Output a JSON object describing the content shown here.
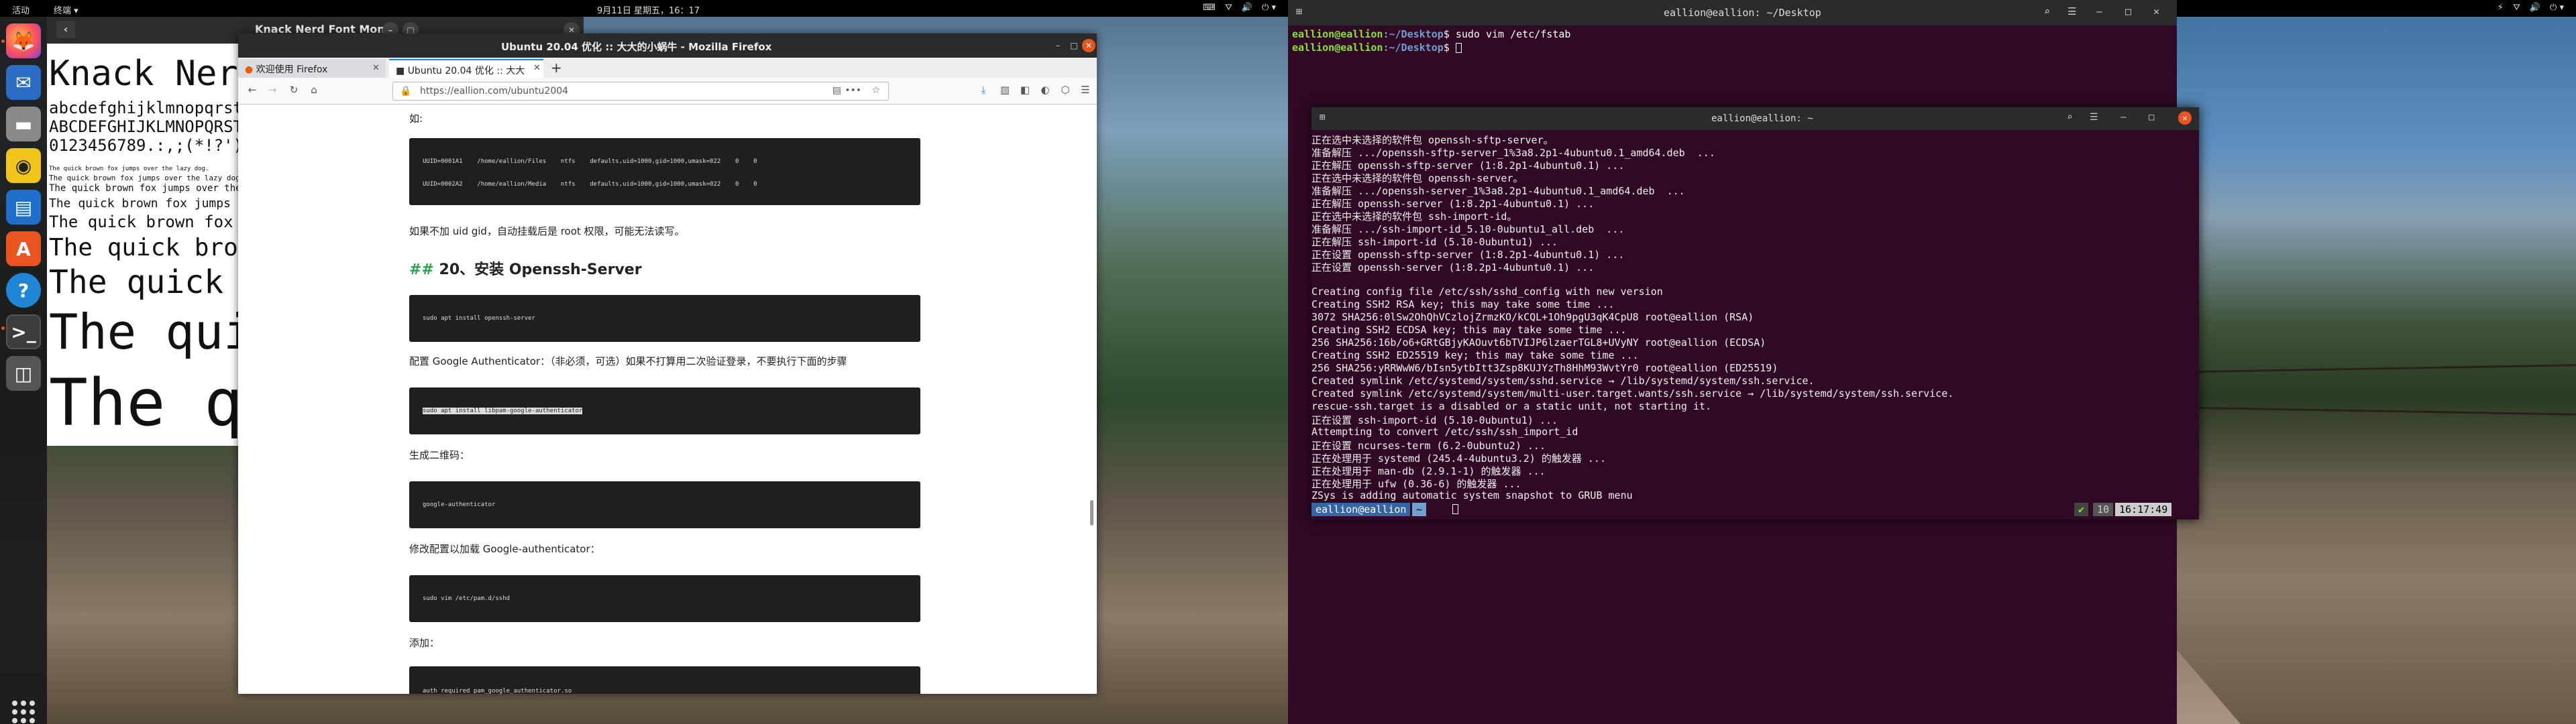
{
  "topbar_left": {
    "activities": "活动",
    "app_menu": "终端 ▾",
    "clock": "9月11日 星期五，16：17"
  },
  "topbar_right": {
    "tray": [
      "⚡",
      "⛛",
      "🔊",
      "⏻ ▾"
    ]
  },
  "dock": {
    "items": [
      "firefox",
      "thunderbird",
      "files",
      "rhythmbox",
      "libreoffice-writer",
      "ubuntu-software",
      "help",
      "terminal",
      "screenshot"
    ],
    "show_apps": "show-applications"
  },
  "font_viewer": {
    "title": "Knack Nerd Font Mono",
    "name_big": "Knack Nerd",
    "lowercase": "abcdefghijklmnopqrst",
    "uppercase": "ABCDEFGHIJKLMNOPQRST",
    "digits": "0123456789.:,;(*!?')",
    "samples": [
      "The quick brown fox jumps over the lazy dog.",
      "The quick brown fox jumps over the lazy dog.",
      "The quick brown fox jumps over the lazy",
      "The quick brown fox jumps",
      "The quick brown fox",
      "The quick bro",
      "The quick",
      "The qui",
      "The q"
    ]
  },
  "firefox": {
    "window_title": "Ubuntu 20.04 优化 :: 大大的小蜗牛 - Mozilla Firefox",
    "tabs": [
      {
        "label": "欢迎使用 Firefox"
      },
      {
        "label": "Ubuntu 20.04 优化 :: 大大"
      }
    ],
    "new_tab": "+",
    "url": "https://eallion.com/ubuntu2004",
    "content": {
      "intro": "如:",
      "fstab_lines": [
        "UUID=0001A1    /home/eallion/Files    ntfs    defaults,uid=1000,gid=1000,umask=022    0    0",
        "UUID=0002A2    /home/eallion/Media    ntfs    defaults,uid=1000,gid=1000,umask=022    0    0"
      ],
      "note": "如果不加 uid gid，自动挂载后是 root 权限，可能无法读写。",
      "heading_hash": "##",
      "heading": "20、安装 Openssh-Server",
      "code1": "sudo apt install openssh-server",
      "ga_line": "配置 Google Authenticator：（非必须，可选）如果不打算用二次验证登录，不要执行下面的步骤",
      "code2": "sudo apt install libpam-google-authenticator",
      "qr_label": "生成二维码：",
      "code3": "google-authenticator",
      "modify_label": "修改配置以加载 Google-authenticator：",
      "code4": "sudo vim /etc/pam.d/sshd",
      "add_label": "添加：",
      "code5": "auth required pam_google_authenticator.so"
    }
  },
  "terminal_desktop": {
    "title": "eallion@eallion: ~/Desktop",
    "lines": [
      {
        "prompt_user": "eallion@eallion",
        "prompt_path": ":~/Desktop",
        "cmd": "$ sudo vim /etc/fstab"
      },
      {
        "prompt_user": "eallion@eallion",
        "prompt_path": ":~/Desktop",
        "cmd": "$ "
      }
    ]
  },
  "terminal_home": {
    "title": "eallion@eallion: ~",
    "lines": [
      "正在选中未选择的软件包 openssh-sftp-server。",
      "准备解压 .../openssh-sftp-server_1%3a8.2p1-4ubuntu0.1_amd64.deb  ...",
      "正在解压 openssh-sftp-server (1:8.2p1-4ubuntu0.1) ...",
      "正在选中未选择的软件包 openssh-server。",
      "准备解压 .../openssh-server_1%3a8.2p1-4ubuntu0.1_amd64.deb  ...",
      "正在解压 openssh-server (1:8.2p1-4ubuntu0.1) ...",
      "正在选中未选择的软件包 ssh-import-id。",
      "准备解压 .../ssh-import-id_5.10-0ubuntu1_all.deb  ...",
      "正在解压 ssh-import-id (5.10-0ubuntu1) ...",
      "正在设置 openssh-sftp-server (1:8.2p1-4ubuntu0.1) ...",
      "正在设置 openssh-server (1:8.2p1-4ubuntu0.1) ...",
      "",
      "Creating config file /etc/ssh/sshd_config with new version",
      "Creating SSH2 RSA key; this may take some time ...",
      "3072 SHA256:0lSw2OhQhVCzlojZrmzKO/kCQL+1Oh9pgU3qK4CpU8 root@eallion (RSA)",
      "Creating SSH2 ECDSA key; this may take some time ...",
      "256 SHA256:16b/o6+GRtGBjyKAOuvt6bTVIJP6lzaerTGL8+UVyNY root@eallion (ECDSA)",
      "Creating SSH2 ED25519 key; this may take some time ...",
      "256 SHA256:yRRWwW6/bIsn5ytbItt3Zsp8KUJYzTh8HhM93WvtYr0 root@eallion (ED25519)",
      "Created symlink /etc/systemd/system/sshd.service → /lib/systemd/system/ssh.service.",
      "Created symlink /etc/systemd/system/multi-user.target.wants/ssh.service → /lib/systemd/system/ssh.service.",
      "rescue-ssh.target is a disabled or a static unit, not starting it.",
      "正在设置 ssh-import-id (5.10-0ubuntu1) ...",
      "Attempting to convert /etc/ssh/ssh_import_id",
      "正在设置 ncurses-term (6.2-0ubuntu2) ...",
      "正在处理用于 systemd (245.4-4ubuntu3.2) 的触发器 ...",
      "正在处理用于 man-db (2.9.1-1) 的触发器 ...",
      "正在处理用于 ufw (0.36-6) 的触发器 ...",
      "ZSys is adding automatic system snapshot to GRUB menu"
    ],
    "prompt": {
      "user": "eallion@eallion",
      "path": "~",
      "status": "✔",
      "num": "10",
      "time": "16:17:49"
    }
  },
  "colors": {
    "ubuntu_orange": "#e95420",
    "terminal_bg": "#300a24",
    "prompt_green": "#8ae234",
    "prompt_blue": "#729fcf",
    "heading_hash": "#2ea44f"
  }
}
